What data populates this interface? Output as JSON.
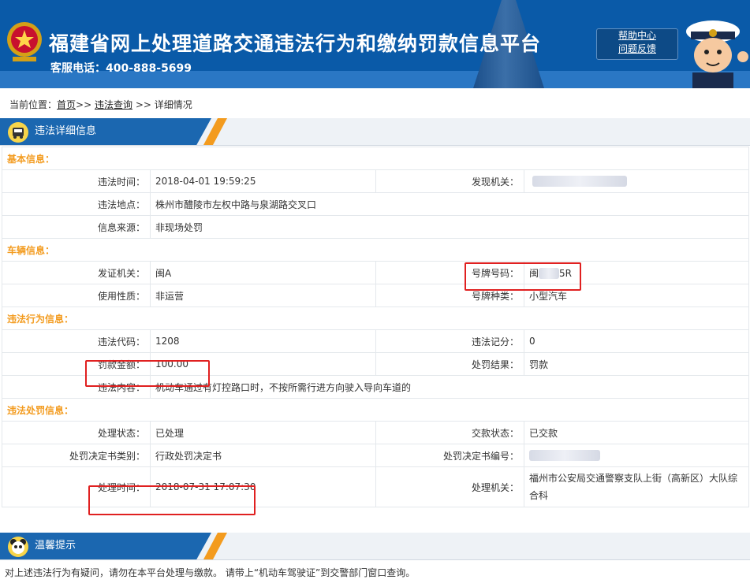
{
  "header": {
    "title": "福建省网上处理道路交通违法行为和缴纳罚款信息平台",
    "hotline": "客服电话：400-888-5699",
    "help_links": [
      "帮助中心",
      "问题反馈"
    ]
  },
  "breadcrumb": {
    "prefix": "当前位置：",
    "home": "首页",
    "sep1": ">>",
    "query": "违法查询",
    "sep2": ">>",
    "current": "详细情况"
  },
  "section": {
    "title": "违法详细信息"
  },
  "basic": {
    "heading": "基本信息：",
    "time_label": "违法时间：",
    "time_value": "2018-04-01 19:59:25",
    "org_label": "发现机关：",
    "place_label": "违法地点：",
    "place_value": "株州市醴陵市左权中路与泉湖路交叉口",
    "source_label": "信息来源：",
    "source_value": "非现场处罚"
  },
  "vehicle": {
    "heading": "车辆信息：",
    "issuer_label": "发证机关：",
    "issuer_value": "闽A",
    "plate_label": "号牌号码：",
    "plate_prefix": "闽",
    "plate_suffix": "5R",
    "nature_label": "使用性质：",
    "nature_value": "非运营",
    "type_label": "号牌种类：",
    "type_value": "小型汽车"
  },
  "violation": {
    "heading": "违法行为信息：",
    "code_label": "违法代码：",
    "code_value": "1208",
    "points_label": "违法记分：",
    "points_value": "0",
    "fine_label": "罚款金额：",
    "fine_value": "100.00",
    "result_label": "处罚结果：",
    "result_value": "罚款",
    "content_label": "违法内容：",
    "content_value": "机动车通过有灯控路口时，不按所需行进方向驶入导向车道的"
  },
  "penalty": {
    "heading": "违法处罚信息：",
    "status_label": "处理状态：",
    "status_value": "已处理",
    "pay_label": "交款状态：",
    "pay_value": "已交款",
    "doc_type_label": "处罚决定书类别：",
    "doc_type_value": "行政处罚决定书",
    "doc_no_label": "处罚决定书编号：",
    "handle_time_label": "处理时间：",
    "handle_time_value": "2018-07-31 17:07:30",
    "handle_org_label": "处理机关：",
    "handle_org_value": "福州市公安局交通警察支队上街（高新区）大队综合科"
  },
  "tips": {
    "title": "温馨提示",
    "text": "对上述违法行为有疑问，请勿在本平台处理与缴款。 请带上“机动车驾驶证”到交警部门窗口查询。"
  },
  "colors": {
    "header_blue": "#0a5aa8",
    "accent_orange": "#f39b1e",
    "highlight_red": "#e02020"
  },
  "icons": [
    "national-emblem-icon",
    "police-mascot-icon",
    "bus-icon",
    "panda-icon"
  ]
}
